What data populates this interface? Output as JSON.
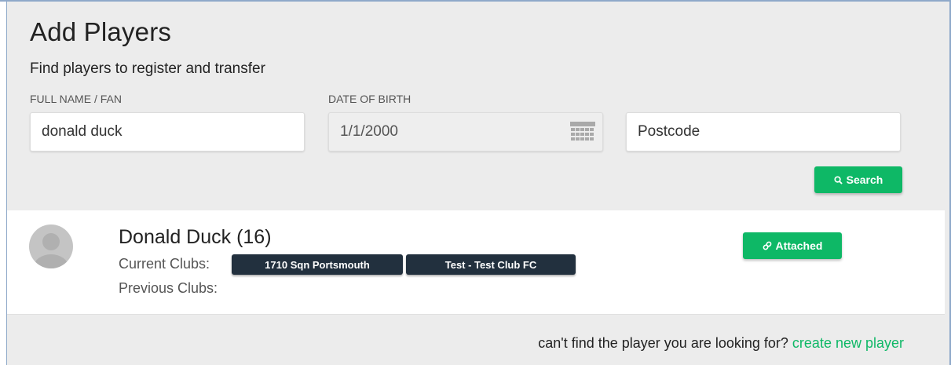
{
  "header": {
    "title": "Add Players",
    "subtitle": "Find players to register and transfer"
  },
  "search_form": {
    "name_label": "FULL NAME / FAN",
    "name_value": "donald duck",
    "dob_label": "DATE OF BIRTH",
    "dob_value": "1/1/2000",
    "postcode_placeholder": "Postcode",
    "search_button_label": "Search"
  },
  "results": [
    {
      "name": "Donald Duck (16)",
      "current_clubs_label": "Current Clubs:",
      "current_clubs": [
        "1710 Sqn Portsmouth",
        "Test - Test Club FC"
      ],
      "previous_clubs_label": "Previous Clubs:",
      "status_button_label": "Attached"
    }
  ],
  "footer": {
    "prompt_text": "can't find the player you are looking for?",
    "create_link_text": "create new player"
  },
  "colors": {
    "accent_green": "#0eb866",
    "club_badge_bg": "#22303e",
    "page_bg": "#ececec"
  }
}
